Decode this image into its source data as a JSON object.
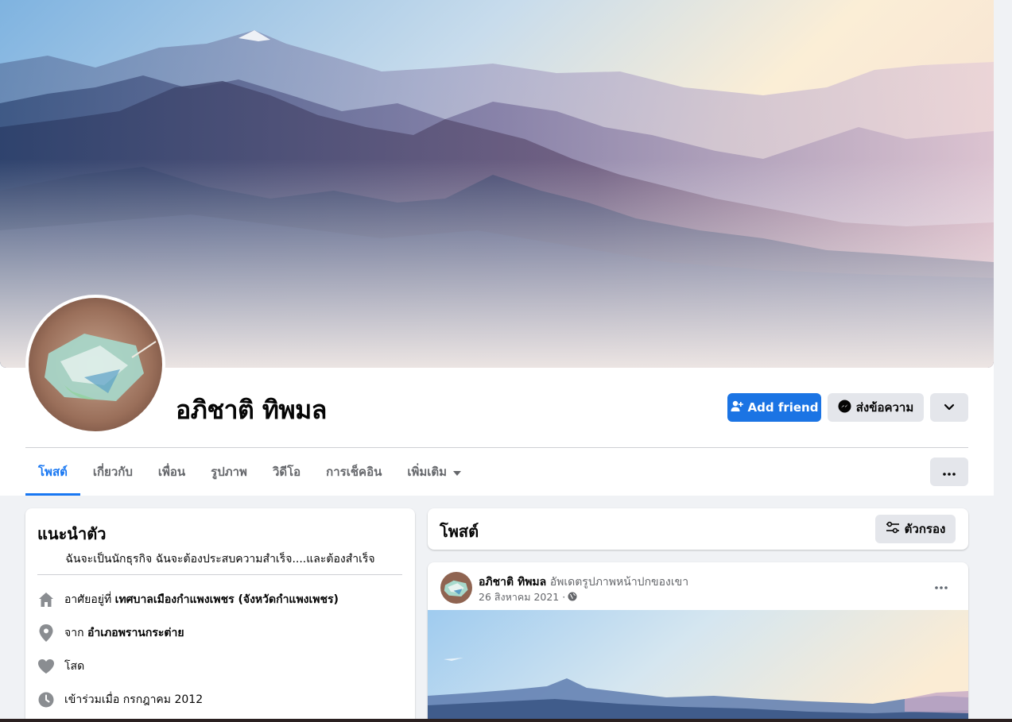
{
  "profile": {
    "name": "อภิชาติ ทิพมล",
    "add_friend_label": "Add friend",
    "message_label": "ส่งข้อความ"
  },
  "tabs": [
    {
      "label": "โพสต์",
      "active": true
    },
    {
      "label": "เกี่ยวกับ"
    },
    {
      "label": "เพื่อน"
    },
    {
      "label": "รูปภาพ"
    },
    {
      "label": "วิดีโอ"
    },
    {
      "label": "การเช็คอิน"
    },
    {
      "label": "เพิ่มเติม"
    }
  ],
  "intro": {
    "title": "แนะนำตัว",
    "bio": "ฉันจะเป็นนักธุรกิจ ฉันจะต้องประสบความสำเร็จ....และต้องสำเร็จ",
    "lives_prefix": "อาศัยอยู่ที่",
    "lives_place": "เทศบาลเมืองกำแพงเพชร (จังหวัดกำแพงเพชร)",
    "from_prefix": "จาก",
    "from_place": "อำเภอพรานกระต่าย",
    "relationship": "โสด",
    "joined": "เข้าร่วมเมื่อ กรกฎาคม 2012"
  },
  "posts": {
    "title": "โพสต์",
    "filter_label": "ตัวกรอง"
  },
  "post": {
    "author": "อภิชาติ ทิพมล",
    "action": "อัพเดตรูปภาพหน้าปกของเขา",
    "date": "26 สิงหาคม 2021 ·"
  },
  "colors": {
    "primary": "#1b74e4",
    "active_tab": "#1877f2",
    "secondary_button": "#e4e6eb"
  }
}
